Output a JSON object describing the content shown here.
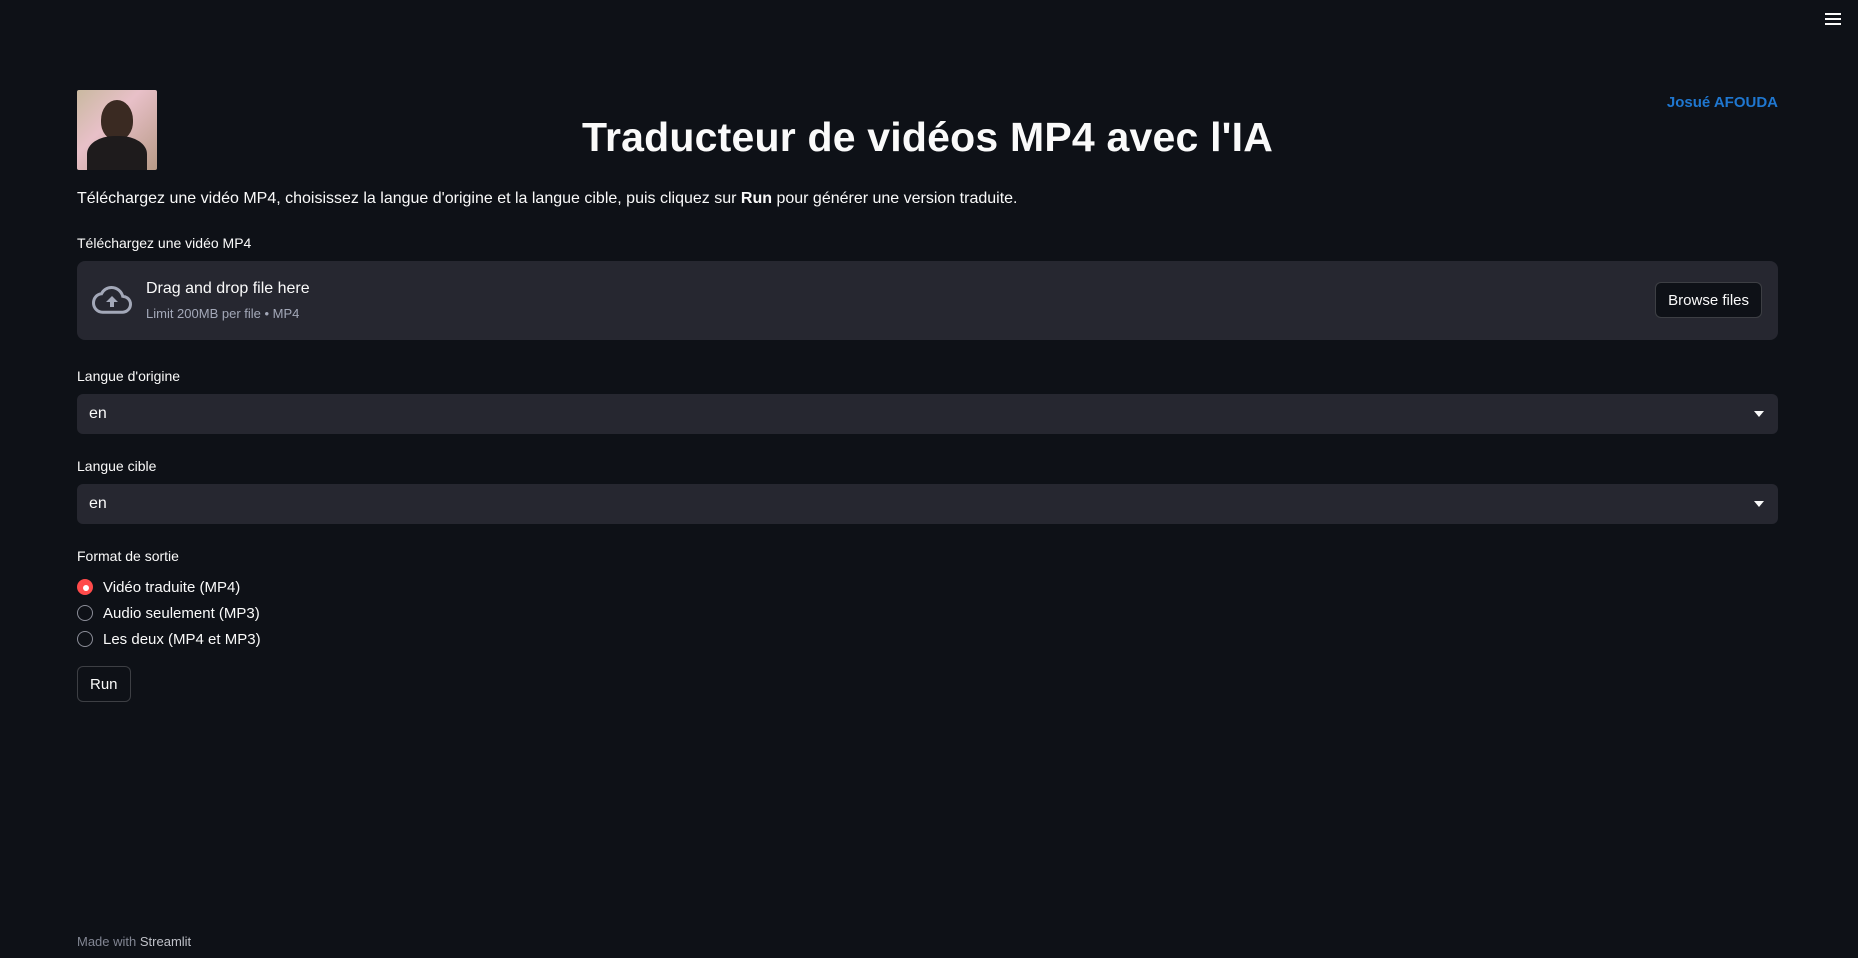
{
  "header": {
    "title": "Traducteur de vidéos MP4 avec l'IA",
    "author": "Josué AFOUDA"
  },
  "intro": {
    "before": "Téléchargez une vidéo MP4, choisissez la langue d'origine et la langue cible, puis cliquez sur ",
    "bold": "Run",
    "after": " pour générer une version traduite."
  },
  "uploader": {
    "label": "Téléchargez une vidéo MP4",
    "drop_text": "Drag and drop file here",
    "limit_text": "Limit 200MB per file • MP4",
    "browse_label": "Browse files"
  },
  "source_language": {
    "label": "Langue d'origine",
    "value": "en"
  },
  "target_language": {
    "label": "Langue cible",
    "value": "en"
  },
  "output_format": {
    "label": "Format de sortie",
    "options": [
      {
        "label": "Vidéo traduite (MP4)",
        "checked": true
      },
      {
        "label": "Audio seulement (MP3)",
        "checked": false
      },
      {
        "label": "Les deux (MP4 et MP3)",
        "checked": false
      }
    ]
  },
  "run_label": "Run",
  "footer": {
    "prefix": "Made with",
    "link": "Streamlit"
  },
  "colors": {
    "background": "#0e1117",
    "widget_bg": "#262730",
    "accent": "#ff4b4b",
    "link": "#1f77d0"
  },
  "icons": [
    "menu-icon",
    "cloud-upload-icon",
    "chevron-down-icon"
  ]
}
